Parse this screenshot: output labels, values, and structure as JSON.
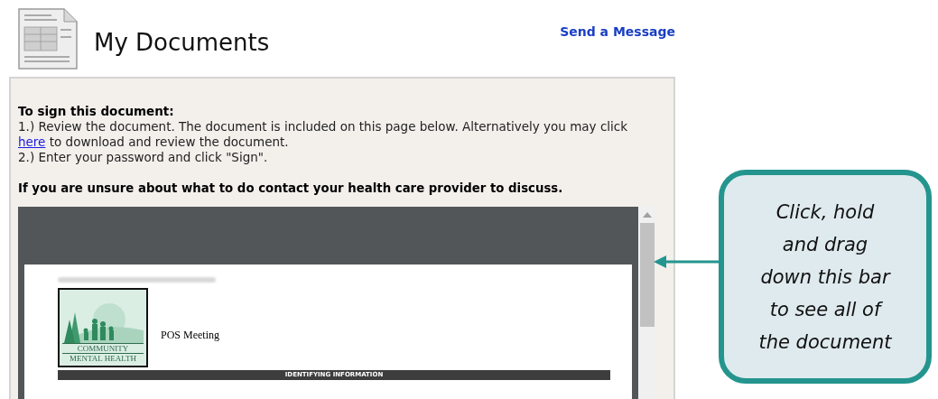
{
  "header": {
    "title": "My Documents",
    "link": "Send a Message"
  },
  "instructions": {
    "heading": "To sign this document:",
    "step1": {
      "before": "1.) Review the document. The document is included on this page below. Alternatively you may click ",
      "link": "here",
      "after": " to download and review the document."
    },
    "step2": "2.) Enter your password and click \"Sign\".",
    "warning": "If you are unsure about what to do contact your health care provider to discuss."
  },
  "document": {
    "logo_text": [
      "COMMUNITY",
      "MENTAL HEALTH"
    ],
    "title": "POS Meeting",
    "section": "IDENTIFYING INFORMATION"
  },
  "callout": {
    "lines": [
      "Click, hold",
      "and drag",
      "down this bar",
      "to see all of",
      "the document"
    ]
  }
}
